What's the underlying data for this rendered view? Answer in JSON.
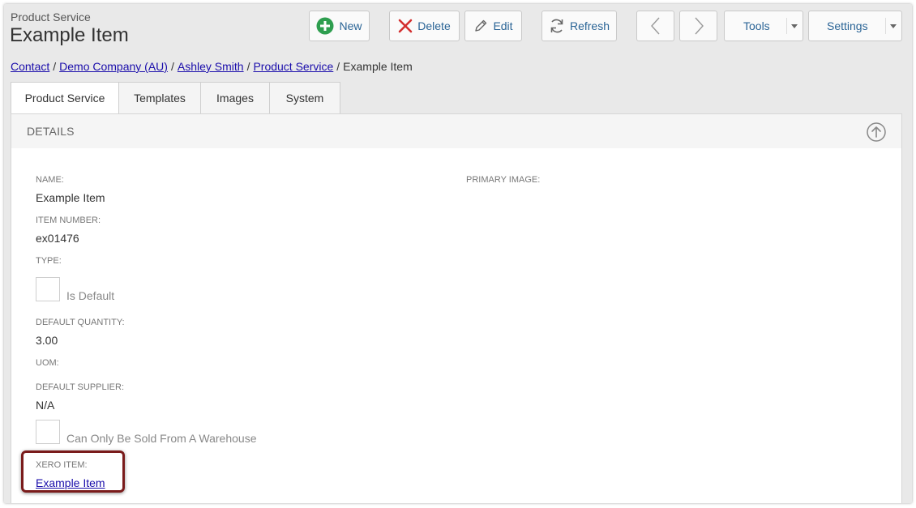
{
  "header": {
    "subtitle": "Product Service",
    "title": "Example Item"
  },
  "toolbar": {
    "new_label": "New",
    "delete_label": "Delete",
    "edit_label": "Edit",
    "refresh_label": "Refresh",
    "tools_label": "Tools",
    "settings_label": "Settings"
  },
  "breadcrumb": {
    "items": [
      "Contact",
      "Demo Company (AU)",
      "Ashley Smith",
      "Product Service"
    ],
    "current": "Example Item",
    "separator": "/"
  },
  "tabs": [
    {
      "label": "Product Service",
      "active": true
    },
    {
      "label": "Templates"
    },
    {
      "label": "Images"
    },
    {
      "label": "System"
    }
  ],
  "details": {
    "heading": "DETAILS",
    "name_label": "NAME:",
    "name_value": "Example Item",
    "primary_image_label": "PRIMARY IMAGE:",
    "item_number_label": "ITEM NUMBER:",
    "item_number_value": "ex01476",
    "type_label": "TYPE:",
    "is_default_label": "Is Default",
    "default_quantity_label": "DEFAULT QUANTITY:",
    "default_quantity_value": "3.00",
    "uom_label": "UOM:",
    "default_supplier_label": "DEFAULT SUPPLIER:",
    "default_supplier_value": "N/A",
    "warehouse_label": "Can Only Be Sold From A Warehouse",
    "xero_item_label": "XERO ITEM:",
    "xero_item_value": "Example Item"
  },
  "colors": {
    "new_icon": "#2e9e4f",
    "delete_icon": "#d32f2f",
    "highlight_border": "#7a1b1b",
    "link": "#1a0dab"
  }
}
